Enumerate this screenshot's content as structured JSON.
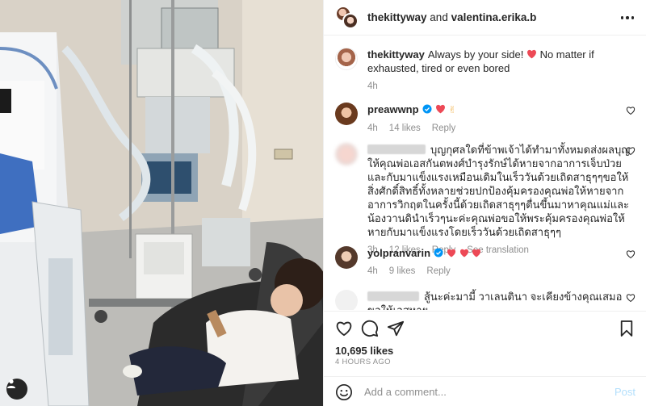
{
  "header": {
    "user1": "thekittyway",
    "conjunction": "and",
    "user2": "valentina.erika.b"
  },
  "caption": {
    "username": "thekittyway",
    "text": "Always by your side!",
    "text_after_heart": "No matter if exhausted, tired or even bored",
    "time": "4h"
  },
  "comments": [
    {
      "username": "preawwnp",
      "verified": true,
      "text": "",
      "emoji": "❤ ✌",
      "time": "4h",
      "likes": "14 likes",
      "reply": "Reply"
    },
    {
      "username": "",
      "text": "บุญกุศลใดที่ข้าพเจ้าได้ทำมาทั้งหมดส่งผลบุญให้คุณพ่อเอสกันตพงศ์บำรุงรักษ์ได้หายจากอาการเจ็บป่วยและกับมาแข็งแรงเหมือนเดิมในเร็ววันด้วยเถิดสาธุๆๆขอให้สิ่งศักดิ์สิทธิ์ทั้งหลายช่วยปกป้องคุ้มครองคุณพ่อให้หายจากอาการวิกฤตในครั้งนี้ด้วยเถิดสาธุๆๆตื่นขึ้นมาหาคุณแม่และน้องวานดินำเร็วๆนะค่ะคุณพ่อขอให้พระคุ้มครองคุณพ่อให้หายกับมาแข็งแรงโดยเร็ววันด้วยเถิดสาธุๆๆ",
      "time": "3h",
      "likes": "12 likes",
      "reply": "Reply",
      "translation": "See translation"
    },
    {
      "username": "yolpranvarin",
      "verified": true,
      "text": "",
      "time": "4h",
      "likes": "9 likes",
      "reply": "Reply"
    },
    {
      "username": "",
      "text": "สู้นะค่ะมามี้ วาเลนตินา จะเคียงข้างคุณเสมอขอให้เอสหาย"
    }
  ],
  "actions": {
    "like_icon": "heart-icon",
    "comment_icon": "comment-icon",
    "share_icon": "send-icon",
    "save_icon": "bookmark-icon"
  },
  "likes_count": "10,695 likes",
  "timestamp": "4 HOURS AGO",
  "add_comment": {
    "placeholder": "Add a comment...",
    "post_label": "Post"
  },
  "colors": {
    "heart_red": "#ed4956",
    "verified_blue": "#0095f6",
    "post_disabled": "#b2dffc",
    "meta_gray": "#8e8e8e"
  }
}
